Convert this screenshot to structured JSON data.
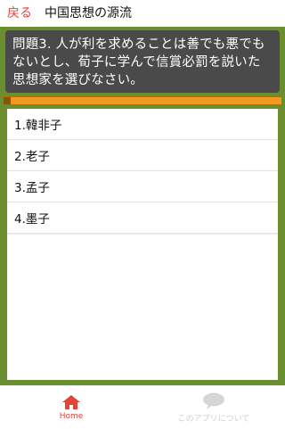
{
  "header": {
    "back_label": "戻る",
    "title": "中国思想の源流"
  },
  "question": {
    "text": "問題3. 人が利を求めることは善でも悪でもないとし、荀子に学んで信賞必罰を説いた思想家を選びなさい。"
  },
  "options": [
    {
      "label": "1.韓非子"
    },
    {
      "label": "2.老子"
    },
    {
      "label": "3.孟子"
    },
    {
      "label": "4.墨子"
    }
  ],
  "bottom_nav": {
    "home_label": "Home",
    "about_label": "このアプリについて"
  },
  "colors": {
    "accent": "#e0453a",
    "background_green": "#6b8e2e",
    "question_bg": "#4a4a4a",
    "progress_orange": "#f29a1f"
  },
  "icons": {
    "home": "home-icon",
    "about": "speech-bubble-icon"
  }
}
